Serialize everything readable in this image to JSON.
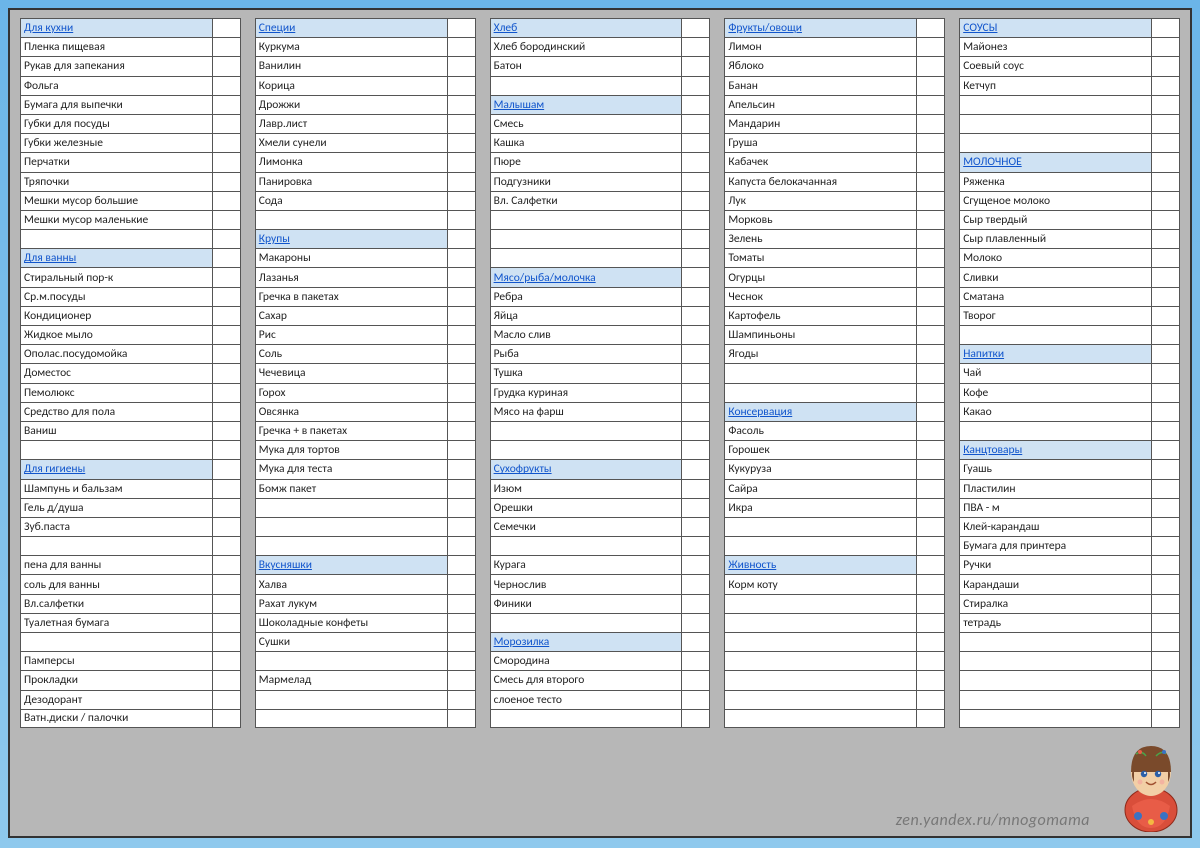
{
  "watermark": "zen.yandex.ru/mnogomama",
  "columns": [
    [
      {
        "t": "Для кухни",
        "h": true
      },
      {
        "t": "Пленка пищевая"
      },
      {
        "t": "Рукав для запекания"
      },
      {
        "t": "Фольга"
      },
      {
        "t": "Бумага для выпечки"
      },
      {
        "t": "Губки для посуды"
      },
      {
        "t": "Губки железные"
      },
      {
        "t": "Перчатки"
      },
      {
        "t": "Тряпочки"
      },
      {
        "t": "Мешки мусор большие"
      },
      {
        "t": "Мешки мусор маленькие"
      },
      {
        "t": ""
      },
      {
        "t": "Для ванны",
        "h": true
      },
      {
        "t": "Стиральный пор-к"
      },
      {
        "t": "Ср.м.посуды"
      },
      {
        "t": "Кондиционер"
      },
      {
        "t": "Жидкое мыло"
      },
      {
        "t": "Ополас.посудомойка"
      },
      {
        "t": "Доместос"
      },
      {
        "t": "Пемолюкс"
      },
      {
        "t": "Средство для пола"
      },
      {
        "t": "Ваниш"
      },
      {
        "t": ""
      },
      {
        "t": "Для гигиены",
        "h": true
      },
      {
        "t": "Шампунь и бальзам"
      },
      {
        "t": "Гель д/душа"
      },
      {
        "t": "Зуб.паста"
      },
      {
        "t": ""
      },
      {
        "t": "пена для ванны"
      },
      {
        "t": "соль для ванны"
      },
      {
        "t": "Вл.салфетки"
      },
      {
        "t": "Туалетная бумага"
      },
      {
        "t": ""
      },
      {
        "t": "Памперсы"
      },
      {
        "t": "Прокладки"
      },
      {
        "t": "Дезодорант"
      },
      {
        "t": "Ватн.диски / палочки"
      }
    ],
    [
      {
        "t": "Специи",
        "h": true
      },
      {
        "t": "Куркума"
      },
      {
        "t": "Ванилин"
      },
      {
        "t": "Корица"
      },
      {
        "t": "Дрожжи"
      },
      {
        "t": "Лавр.лист"
      },
      {
        "t": "Хмели сунели"
      },
      {
        "t": "Лимонка"
      },
      {
        "t": "Панировка"
      },
      {
        "t": "Сода"
      },
      {
        "t": ""
      },
      {
        "t": "Крупы",
        "h": true
      },
      {
        "t": "Макароны"
      },
      {
        "t": "Лазанья"
      },
      {
        "t": "Гречка в пакетах"
      },
      {
        "t": "Сахар"
      },
      {
        "t": "Рис"
      },
      {
        "t": "Соль"
      },
      {
        "t": "Чечевица"
      },
      {
        "t": "Горох"
      },
      {
        "t": "Овсянка"
      },
      {
        "t": "Гречка + в пакетах"
      },
      {
        "t": "Мука для тортов"
      },
      {
        "t": "Мука для теста"
      },
      {
        "t": "Бомж пакет"
      },
      {
        "t": ""
      },
      {
        "t": ""
      },
      {
        "t": ""
      },
      {
        "t": "Вкусняшки",
        "h": true
      },
      {
        "t": "Халва"
      },
      {
        "t": "Рахат лукум"
      },
      {
        "t": "Шоколадные конфеты"
      },
      {
        "t": "Сушки"
      },
      {
        "t": ""
      },
      {
        "t": "Мармелад"
      },
      {
        "t": ""
      },
      {
        "t": ""
      }
    ],
    [
      {
        "t": "Хлеб",
        "h": true
      },
      {
        "t": "Хлеб бородинский"
      },
      {
        "t": "Батон"
      },
      {
        "t": ""
      },
      {
        "t": "Малышам",
        "h": true
      },
      {
        "t": "Смесь"
      },
      {
        "t": "Кашка"
      },
      {
        "t": "Пюре"
      },
      {
        "t": "Подгузники"
      },
      {
        "t": "Вл. Салфетки"
      },
      {
        "t": ""
      },
      {
        "t": ""
      },
      {
        "t": ""
      },
      {
        "t": "Мясо/рыба/молочка",
        "h": true
      },
      {
        "t": "Ребра"
      },
      {
        "t": "Яйца"
      },
      {
        "t": "Масло слив"
      },
      {
        "t": "Рыба"
      },
      {
        "t": "Тушка"
      },
      {
        "t": "Грудка куриная"
      },
      {
        "t": "Мясо на фарш"
      },
      {
        "t": ""
      },
      {
        "t": ""
      },
      {
        "t": "Сухофрукты",
        "h": true
      },
      {
        "t": "Изюм"
      },
      {
        "t": "Орешки"
      },
      {
        "t": "Семечки"
      },
      {
        "t": ""
      },
      {
        "t": "Курага"
      },
      {
        "t": "Чернослив"
      },
      {
        "t": "Финики"
      },
      {
        "t": ""
      },
      {
        "t": "Морозилка",
        "h": true
      },
      {
        "t": "Смородина"
      },
      {
        "t": "Смесь для второго"
      },
      {
        "t": "слоеное тесто"
      },
      {
        "t": ""
      }
    ],
    [
      {
        "t": "Фрукты/овощи",
        "h": true
      },
      {
        "t": "Лимон"
      },
      {
        "t": "Яблоко"
      },
      {
        "t": "Банан"
      },
      {
        "t": "Апельсин"
      },
      {
        "t": "Мандарин"
      },
      {
        "t": "Груша"
      },
      {
        "t": "Кабачек"
      },
      {
        "t": "Капуста белокачанная"
      },
      {
        "t": "Лук"
      },
      {
        "t": "Морковь"
      },
      {
        "t": "Зелень"
      },
      {
        "t": "Томаты"
      },
      {
        "t": "Огурцы"
      },
      {
        "t": "Чеснок"
      },
      {
        "t": "Картофель"
      },
      {
        "t": "Шампиньоны"
      },
      {
        "t": "Ягоды"
      },
      {
        "t": ""
      },
      {
        "t": ""
      },
      {
        "t": "Консервация",
        "h": true
      },
      {
        "t": "Фасоль"
      },
      {
        "t": "Горошек"
      },
      {
        "t": "Кукуруза"
      },
      {
        "t": "Сайра"
      },
      {
        "t": "Икра"
      },
      {
        "t": ""
      },
      {
        "t": ""
      },
      {
        "t": "Живность",
        "h": true
      },
      {
        "t": "Корм коту"
      },
      {
        "t": ""
      },
      {
        "t": ""
      },
      {
        "t": ""
      },
      {
        "t": ""
      },
      {
        "t": ""
      },
      {
        "t": ""
      },
      {
        "t": ""
      }
    ],
    [
      {
        "t": "СОУСЫ",
        "h": true
      },
      {
        "t": "Майонез"
      },
      {
        "t": "Соевый соус"
      },
      {
        "t": "Кетчуп"
      },
      {
        "t": ""
      },
      {
        "t": ""
      },
      {
        "t": ""
      },
      {
        "t": "МОЛОЧНОЕ",
        "h": true
      },
      {
        "t": "Ряженка"
      },
      {
        "t": "Сгущеное молоко"
      },
      {
        "t": "Сыр твердый"
      },
      {
        "t": "Сыр плавленный"
      },
      {
        "t": "Молоко"
      },
      {
        "t": "Сливки"
      },
      {
        "t": "Сматана"
      },
      {
        "t": "Творог"
      },
      {
        "t": ""
      },
      {
        "t": "Напитки",
        "h": true
      },
      {
        "t": "Чай"
      },
      {
        "t": "Кофе"
      },
      {
        "t": "Какао"
      },
      {
        "t": ""
      },
      {
        "t": "Канцтовары",
        "h": true
      },
      {
        "t": "Гуашь"
      },
      {
        "t": "Пластилин"
      },
      {
        "t": "ПВА - м"
      },
      {
        "t": "Клей-карандаш"
      },
      {
        "t": "Бумага для принтера"
      },
      {
        "t": "Ручки"
      },
      {
        "t": "Карандаши"
      },
      {
        "t": "Стиралка"
      },
      {
        "t": "тетрадь"
      },
      {
        "t": ""
      },
      {
        "t": ""
      },
      {
        "t": ""
      },
      {
        "t": ""
      },
      {
        "t": ""
      }
    ]
  ]
}
